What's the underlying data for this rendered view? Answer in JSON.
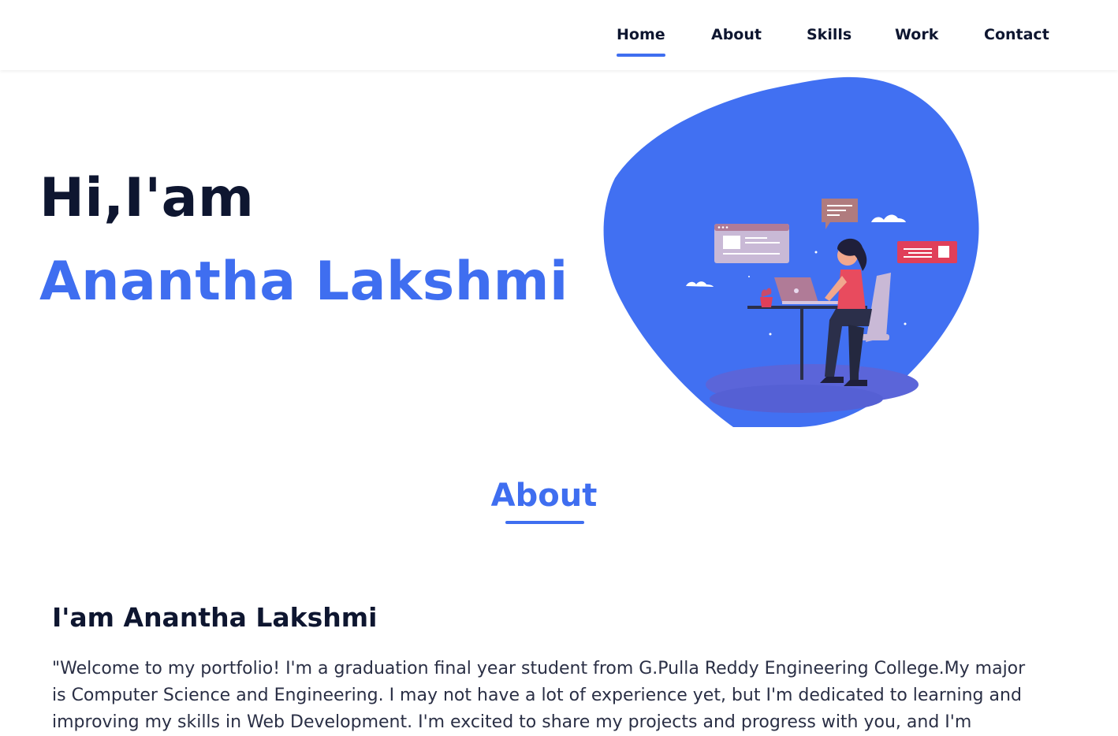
{
  "nav": {
    "items": [
      {
        "label": "Home",
        "active": true
      },
      {
        "label": "About",
        "active": false
      },
      {
        "label": "Skills",
        "active": false
      },
      {
        "label": "Work",
        "active": false
      },
      {
        "label": "Contact",
        "active": false
      }
    ]
  },
  "hero": {
    "greeting": "Hi,I'am",
    "name": "Anantha Lakshmi",
    "illustration": "woman-working-on-laptop-illustration"
  },
  "about": {
    "title": "About",
    "subtitle": "I'am Anantha Lakshmi",
    "text": "\"Welcome to my portfolio! I'm a graduation final year student from G.Pulla Reddy Engineering College.My major is Computer Science and Engineering. I may not have a lot of experience yet, but I'm dedicated to learning and improving my skills in Web Development. I'm excited to share my projects and progress with you, and I'm"
  },
  "colors": {
    "accent": "#3f6ef0",
    "heading": "#0e1630",
    "text": "#2a2f45"
  }
}
